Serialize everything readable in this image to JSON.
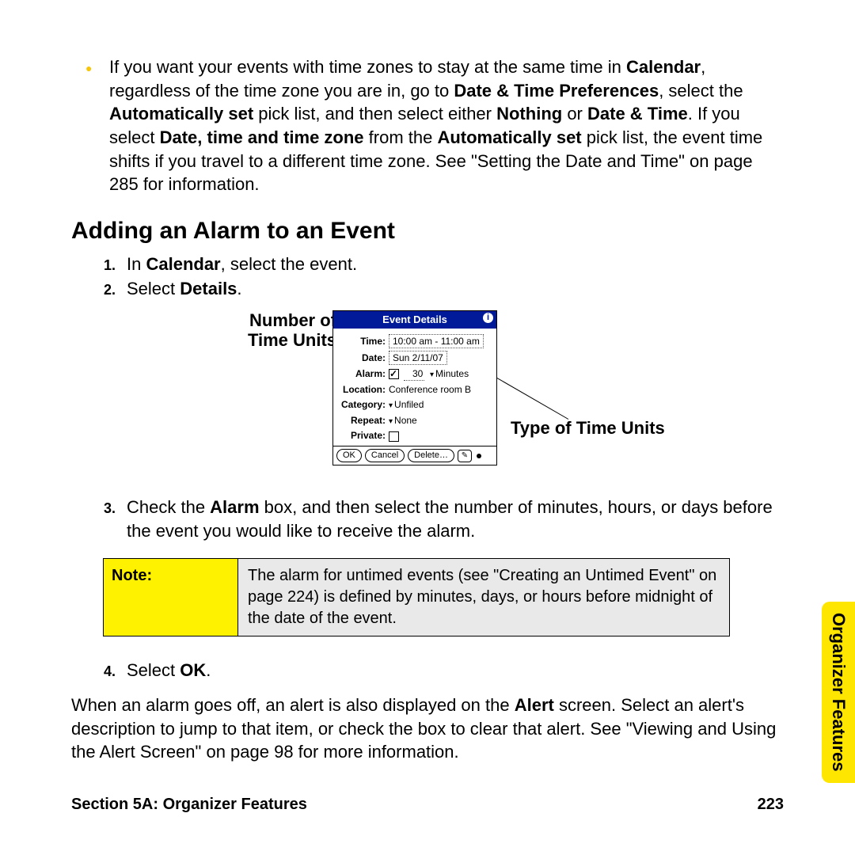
{
  "intro": {
    "text_parts": {
      "p1": "If you want your events with time zones to stay at the same time in ",
      "b1": "Calendar",
      "p2": ", regardless of the time zone you are in, go to ",
      "b2": "Date & Time Preferences",
      "p3": ", select the ",
      "b3": "Automatically set",
      "p4": " pick list, and then select either ",
      "b4": "Nothing",
      "p5": " or ",
      "b5": "Date & Time",
      "p6": ". If you select ",
      "b6": "Date, time and time zone",
      "p7": " from the ",
      "b7": "Automatically set",
      "p8": " pick list, the event time shifts if you travel to a different time zone. See \"Setting the Date and Time\" on page 285 for information."
    }
  },
  "heading": "Adding an Alarm to an Event",
  "steps": {
    "s1": {
      "n": "1.",
      "pre": "In ",
      "b": "Calendar",
      "post": ", select the event."
    },
    "s2": {
      "n": "2.",
      "pre": "Select ",
      "b": "Details",
      "post": "."
    },
    "s3": {
      "n": "3.",
      "pre": "Check the ",
      "b": "Alarm",
      "post": " box, and then select the number of minutes, hours, or days before the event you would like to receive the alarm."
    },
    "s4": {
      "n": "4.",
      "pre": "Select ",
      "b": "OK",
      "post": "."
    }
  },
  "callouts": {
    "left_line1": "Number of",
    "left_line2": "Time Units",
    "right": "Type of Time Units"
  },
  "dialog": {
    "title": "Event Details",
    "rows": {
      "time": {
        "label": "Time:",
        "value": "10:00 am - 11:00 am"
      },
      "date": {
        "label": "Date:",
        "value": "Sun 2/11/07"
      },
      "alarm": {
        "label": "Alarm:",
        "num": "30",
        "unit": "Minutes"
      },
      "location": {
        "label": "Location:",
        "value": "Conference room B"
      },
      "category": {
        "label": "Category:",
        "value": "Unfiled"
      },
      "repeat": {
        "label": "Repeat:",
        "value": "None"
      },
      "private": {
        "label": "Private:"
      }
    },
    "buttons": {
      "ok": "OK",
      "cancel": "Cancel",
      "delete": "Delete…"
    }
  },
  "note": {
    "label": "Note:",
    "text": "The alarm for untimed events (see \"Creating an Untimed Event\" on page 224) is defined by minutes, days, or hours before midnight of the date of the event."
  },
  "after": {
    "p1": "When an alarm goes off, an alert is also displayed on the ",
    "b1": "Alert",
    "p2": " screen. Select an alert's description to jump to that item, or check the box to clear that alert. See \"Viewing and Using the Alert Screen\" on page 98 for more information."
  },
  "side_tab": "Organizer Features",
  "footer": {
    "left": "Section 5A: Organizer Features",
    "right": "223"
  }
}
